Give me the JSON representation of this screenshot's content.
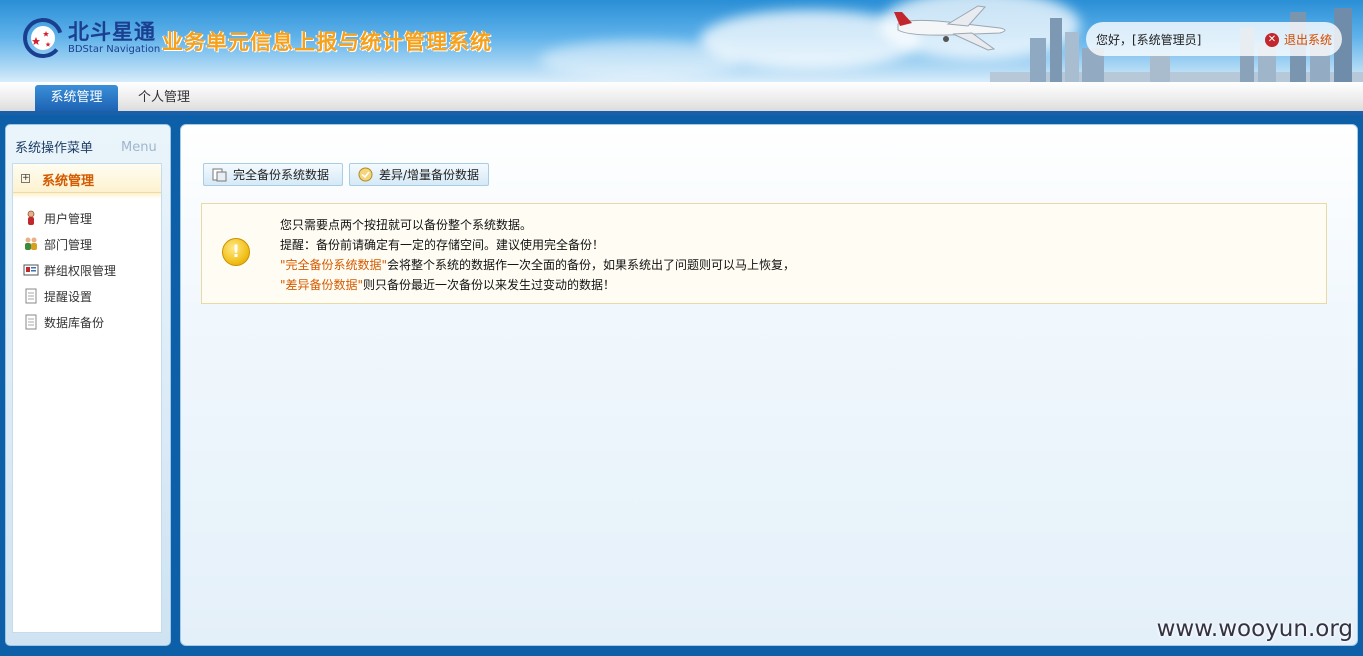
{
  "header": {
    "logo_cn": "北斗星通",
    "logo_en": "BDStar Navigation",
    "system_title": "业务单元信息上报与统计管理系统",
    "welcome_text": "您好，[系统管理员]",
    "logout_label": "退出系统"
  },
  "nav": {
    "tabs": [
      {
        "label": "系统管理",
        "active": true
      },
      {
        "label": "个人管理",
        "active": false
      }
    ]
  },
  "sidebar": {
    "title_cn": "系统操作菜单",
    "title_en": "Menu",
    "group_label": "系统管理",
    "group_toggle": "+",
    "items": [
      {
        "label": "用户管理",
        "icon": "user-icon"
      },
      {
        "label": "部门管理",
        "icon": "group-icon"
      },
      {
        "label": "群组权限管理",
        "icon": "permission-icon"
      },
      {
        "label": "提醒设置",
        "icon": "document-icon"
      },
      {
        "label": "数据库备份",
        "icon": "document-icon"
      }
    ]
  },
  "main": {
    "buttons": [
      {
        "label": "完全备份系统数据",
        "icon": "backup-icon"
      },
      {
        "label": "差异/增量备份数据",
        "icon": "diff-backup-icon"
      }
    ],
    "notice": {
      "line1": "您只需要点两个按扭就可以备份整个系统数据。",
      "line2": "提醒：备份前请确定有一定的存储空间。建议使用完全备份！",
      "line3_highlight": "\"完全备份系统数据\"",
      "line3_rest": "会将整个系统的数据作一次全面的备份，如果系统出了问题则可以马上恢复，",
      "line4_highlight": "\"差异备份数据\"",
      "line4_rest": "则只备份最近一次备份以来发生过变动的数据！"
    }
  },
  "watermark": "www.wooyun.org",
  "colors": {
    "brand_blue": "#1b3f8f",
    "title_orange": "#f7a11a",
    "highlight_orange": "#d45a00",
    "frame_blue": "#0d5fa8"
  }
}
